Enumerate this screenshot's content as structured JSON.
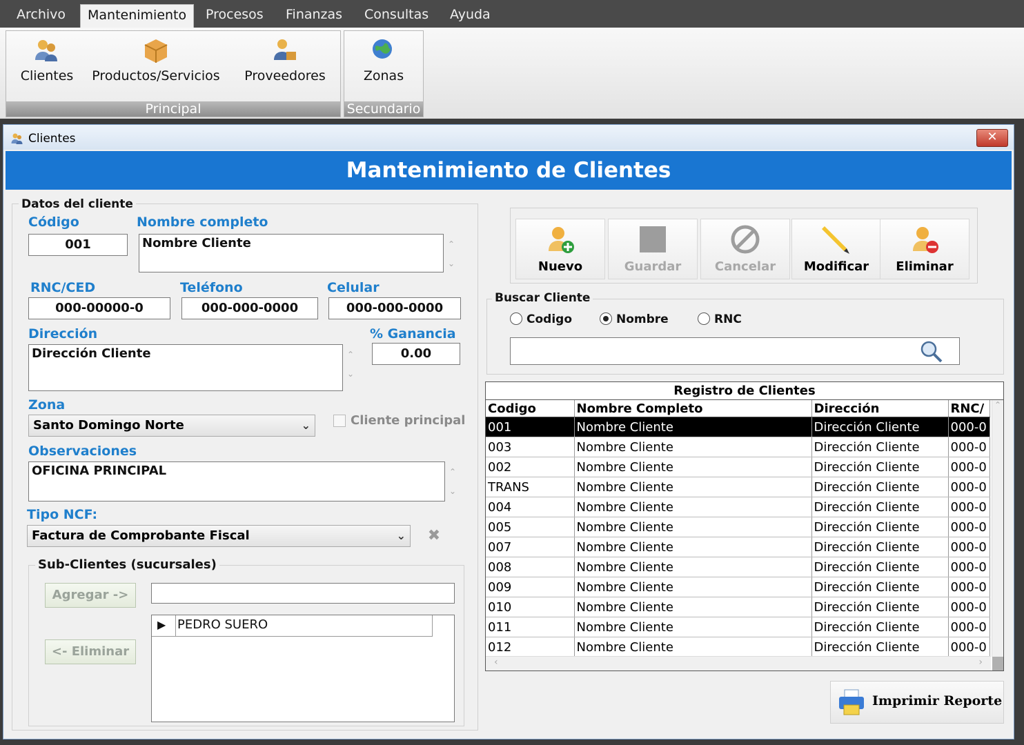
{
  "menubar": {
    "items": [
      "Archivo",
      "Mantenimiento",
      "Procesos",
      "Finanzas",
      "Consultas",
      "Ayuda"
    ]
  },
  "ribbon": {
    "principal": {
      "label": "Principal",
      "buttons": [
        "Clientes",
        "Productos/Servicios",
        "Proveedores"
      ]
    },
    "secundario": {
      "label": "Secundario",
      "buttons": [
        "Zonas"
      ]
    }
  },
  "window": {
    "title": "Clientes",
    "close": "✕",
    "banner": "Mantenimiento de Clientes"
  },
  "datos": {
    "frame_title": "Datos del cliente",
    "codigo_label": "Código",
    "codigo": "001",
    "nombre_label": "Nombre completo",
    "nombre": "Nombre Cliente",
    "rnc_label": "RNC/CED",
    "rnc": "000-00000-0",
    "telefono_label": "Teléfono",
    "telefono": "000-000-0000",
    "celular_label": "Celular",
    "celular": "000-000-0000",
    "direccion_label": "Dirección",
    "direccion": "Dirección Cliente",
    "ganancia_label": "% Ganancia",
    "ganancia": "0.00",
    "zona_label": "Zona",
    "zona": "Santo Domingo Norte",
    "cliente_principal": "Cliente principal",
    "observaciones_label": "Observaciones",
    "observaciones": "OFICINA PRINCIPAL",
    "ncf_label": "Tipo NCF:",
    "ncf": "Factura de Comprobante Fiscal"
  },
  "subclientes": {
    "title": "Sub-Clientes (sucursales)",
    "agregar": "Agregar ->",
    "eliminar": "<- Eliminar",
    "input": "",
    "items": [
      "PEDRO SUERO"
    ]
  },
  "toolbar": {
    "nuevo": "Nuevo",
    "guardar": "Guardar",
    "cancelar": "Cancelar",
    "modificar": "Modificar",
    "eliminar": "Eliminar"
  },
  "buscar": {
    "title": "Buscar Cliente",
    "options": [
      "Codigo",
      "Nombre",
      "RNC"
    ],
    "selected": "Nombre",
    "query": ""
  },
  "registro": {
    "title": "Registro de Clientes",
    "columns": [
      "Codigo",
      "Nombre Completo",
      "Dirección",
      "RNC/"
    ],
    "rows": [
      [
        "001",
        "Nombre Cliente",
        "Dirección Cliente",
        "000-0"
      ],
      [
        "003",
        "Nombre Cliente",
        "Dirección Cliente",
        "000-0"
      ],
      [
        "002",
        "Nombre Cliente",
        "Dirección Cliente",
        "000-0"
      ],
      [
        "TRANS",
        "Nombre Cliente",
        "Dirección Cliente",
        "000-0"
      ],
      [
        "004",
        "Nombre Cliente",
        "Dirección Cliente",
        "000-0"
      ],
      [
        "005",
        "Nombre Cliente",
        "Dirección Cliente",
        "000-0"
      ],
      [
        "007",
        "Nombre Cliente",
        "Dirección Cliente",
        "000-0"
      ],
      [
        "008",
        "Nombre Cliente",
        "Dirección Cliente",
        "000-0"
      ],
      [
        "009",
        "Nombre Cliente",
        "Dirección Cliente",
        "000-0"
      ],
      [
        "010",
        "Nombre Cliente",
        "Dirección Cliente",
        "000-0"
      ],
      [
        "011",
        "Nombre Cliente",
        "Dirección Cliente",
        "000-0"
      ],
      [
        "012",
        "Nombre Cliente",
        "Dirección Cliente",
        "000-0"
      ]
    ]
  },
  "imprimir": "Imprimir Reporte",
  "icons": {
    "clientes": "users-icon",
    "productos": "box-icon",
    "proveedores": "supplier-icon",
    "zonas": "globe-icon",
    "buscar": "search-icon",
    "imprimir": "printer-icon",
    "clear": "clear-x-icon"
  },
  "colors": {
    "banner": "#1976d2",
    "label": "#1f7fcc",
    "selected_row": "#000000"
  }
}
